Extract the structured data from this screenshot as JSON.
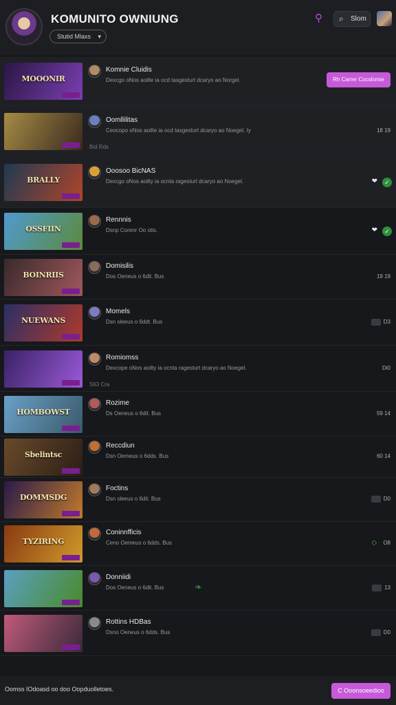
{
  "header": {
    "title": "KOMUNITO OWNIUNG",
    "filter": "Stutid Mlaxs",
    "search_label": "Slom",
    "purple_icon": "search-icon"
  },
  "rows": [
    {
      "name": "Komnie Cluidis",
      "desc": "Dexcgo oNos aoilte ia ocd tasgesturt dcaryo ao Norgel.",
      "meta": "",
      "count": "",
      "action": "Rh Carrer Cocslomie",
      "thumb_title": "MOOONIR",
      "c1": "#2a1745",
      "c2": "#7b3fb3",
      "avatar": "#b28a66"
    },
    {
      "name": "Oomllilitas",
      "desc": "Ceocopo oNos aoilte ia ocd tasgesturt dcaryo ao Noegel. Iy",
      "meta": "Bid Rds",
      "count": "18 19",
      "action": "",
      "thumb_title": "",
      "c1": "#a58c45",
      "c2": "#3b2a1f",
      "avatar": "#6a7fc0"
    },
    {
      "name": "Ooosoo BicNAS",
      "desc": "Dexcgo oNos aoilty ia ocnta ragesturt dcaryo ao Noegel.",
      "meta": "",
      "count": "",
      "action": "",
      "thumb_title": "BRALLY",
      "c1": "#1f3a52",
      "c2": "#b0452a",
      "avatar": "#d9a03a"
    },
    {
      "name": "Rennnis",
      "desc": "Dsnp Corenr Oo otis.",
      "meta": "",
      "count": "",
      "action": "",
      "thumb_title": "OSSFIIN",
      "c1": "#4f9ad0",
      "c2": "#5c8a3c",
      "avatar": "#9a6a4a"
    },
    {
      "name": "Domisilis",
      "desc": "Dos Oeneus o 6dit. Bus",
      "meta": "",
      "count": "19 19",
      "action": "",
      "thumb_title": "BOINRIIS",
      "c1": "#3a2a2c",
      "c2": "#a0585c",
      "avatar": "#8a6a5a"
    },
    {
      "name": "Momels",
      "desc": "Dsn sleeus o 6ddt. Bus",
      "meta": "",
      "count": "D3",
      "action": "",
      "thumb_title": "NUEWANS",
      "c1": "#2a2f66",
      "c2": "#b03a2a",
      "avatar": "#7c7cc0"
    },
    {
      "name": "Romiomss",
      "desc": "Dexcope oNos aoilty ia ocnta ragesturt dcaryo ao Noegel.",
      "meta": "S63 Cra",
      "count": "Di0",
      "action": "",
      "thumb_title": "",
      "c1": "#3a2266",
      "c2": "#9a5ad8",
      "avatar": "#c08a6a"
    },
    {
      "name": "Rozime",
      "desc": "Ds Oeneus o 6dit. Bus",
      "meta": "",
      "count": "59 14",
      "action": "",
      "thumb_title": "HOMBOWST",
      "c1": "#6aa0c8",
      "c2": "#3a5a6a",
      "avatar": "#b05a5a"
    },
    {
      "name": "Reccdiun",
      "desc": "Dsn Oemeus o 6dds. Bus",
      "meta": "",
      "count": "60 14",
      "action": "",
      "thumb_title": "Sbelintsc",
      "c1": "#6a4a2a",
      "c2": "#2a1f17",
      "avatar": "#c07030"
    },
    {
      "name": "Foctins",
      "desc": "Dsn sleeus o 6dit. Bus",
      "meta": "",
      "count": "D0",
      "action": "",
      "thumb_title": "DOMMSDG",
      "c1": "#2a1a4a",
      "c2": "#c07a2a",
      "avatar": "#a07a5a"
    },
    {
      "name": "Coninnfficis",
      "desc": "Ceno Oemeus o 6dds. Bus",
      "meta": "",
      "count": "O8",
      "action": "",
      "thumb_title": "TYZIRING",
      "c1": "#8a3a12",
      "c2": "#d09a2a",
      "avatar": "#c06a3a"
    },
    {
      "name": "Donniidi",
      "desc": "Dos Oeneus o 6dit. Bus",
      "meta": "",
      "count": "13",
      "action": "",
      "thumb_title": "",
      "c1": "#5aa0c0",
      "c2": "#4a8a2a",
      "avatar": "#7a5ab0"
    },
    {
      "name": "Rottins HDBas",
      "desc": "Dsno Oeneus o 6dds. Bus",
      "meta": "",
      "count": "D0",
      "action": "",
      "thumb_title": "",
      "c1": "#c05a7a",
      "c2": "#3a2a3a",
      "avatar": "#8a8a8a"
    }
  ],
  "footer": {
    "text": "Oomss IOdoasd oo doo Oopduolletoes.",
    "button": "C Ooonsoeedioo"
  },
  "colors": {
    "accent": "#c65ad9",
    "background": "#17181b",
    "success": "#2f8f3c"
  }
}
